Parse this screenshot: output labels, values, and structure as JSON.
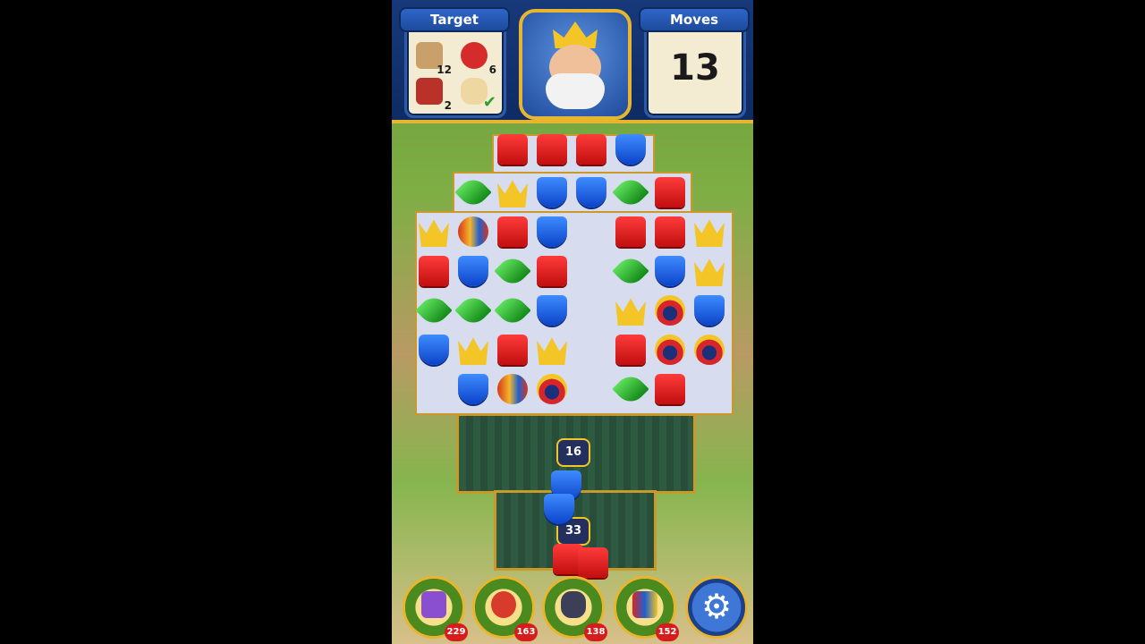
{
  "hud": {
    "target_label": "Target",
    "moves_label": "Moves",
    "moves_value": "13",
    "goals": [
      {
        "icon": "dog-icon",
        "count": "12"
      },
      {
        "icon": "parrot-icon",
        "count": "6"
      },
      {
        "icon": "dog-house-icon",
        "count": "2"
      },
      {
        "icon": "bone-icon",
        "done": true
      }
    ]
  },
  "board": {
    "counters": {
      "top": "16",
      "bottom": "33"
    }
  },
  "boosters": [
    {
      "icon": "hammer-icon",
      "count": "229"
    },
    {
      "icon": "arrow-icon",
      "count": "163"
    },
    {
      "icon": "cannon-icon",
      "count": "138"
    },
    {
      "icon": "jester-hat-icon",
      "count": "152"
    }
  ],
  "colors": {
    "red": "#e01f1f",
    "blue": "#1e5be0",
    "green": "#2bb52b",
    "gold": "#f3c526"
  }
}
